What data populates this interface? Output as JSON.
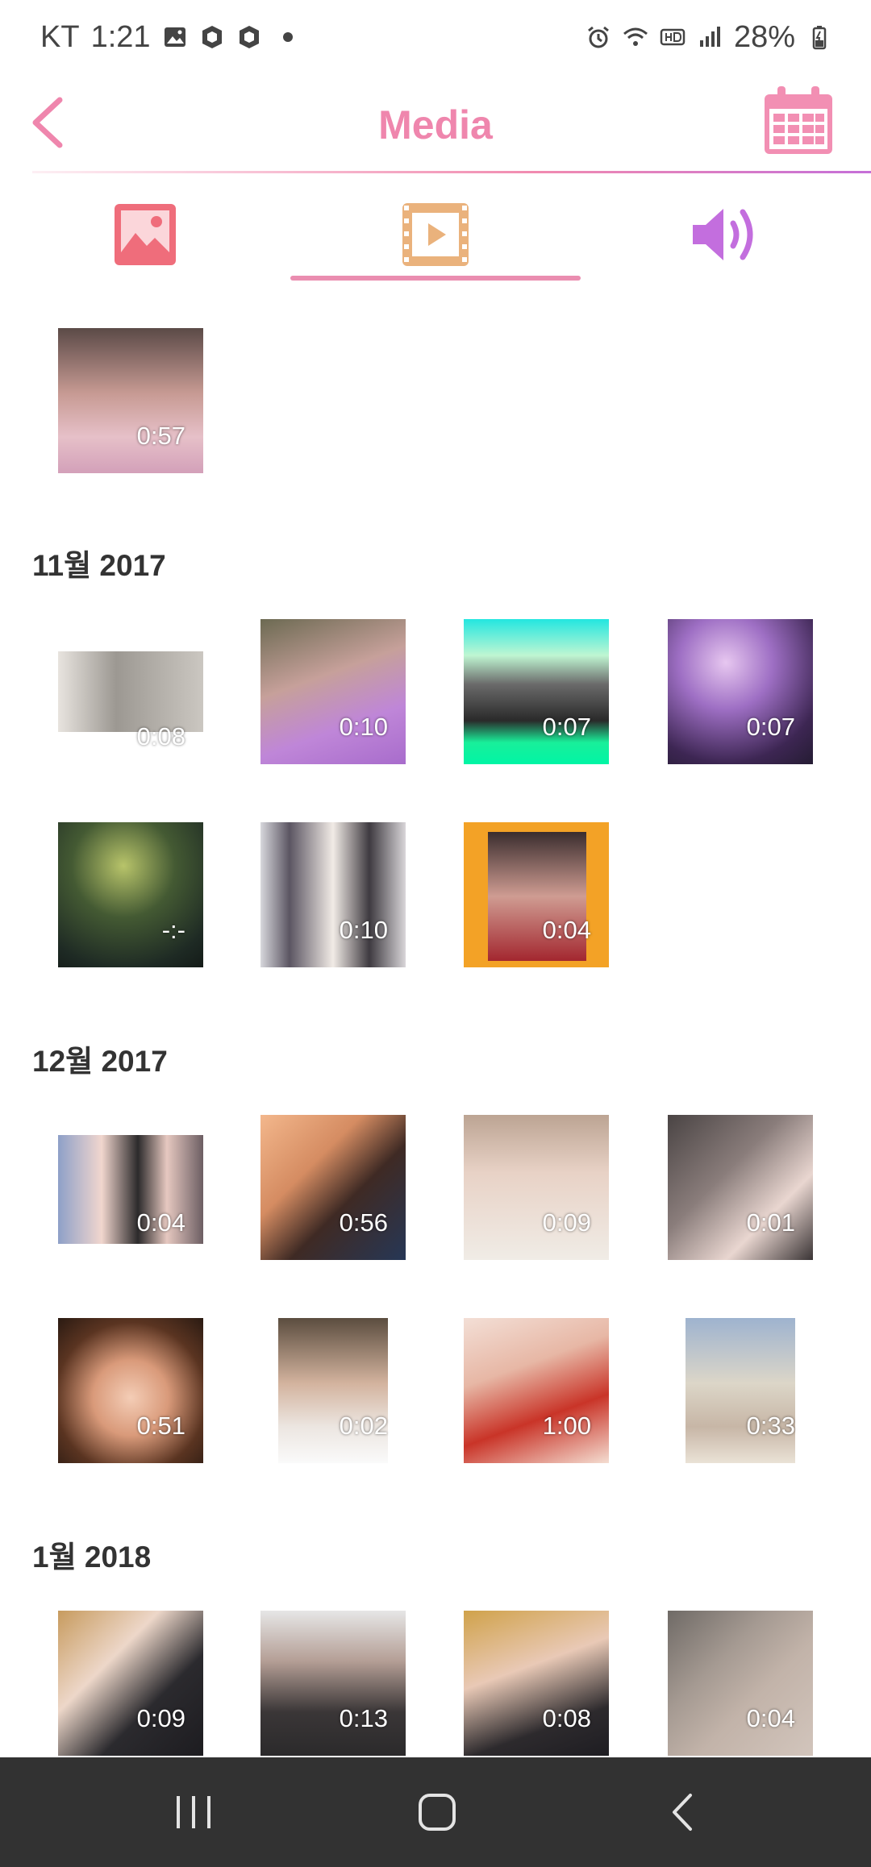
{
  "status_bar": {
    "carrier": "KT",
    "time": "1:21",
    "battery": "28%"
  },
  "app_bar": {
    "title": "Media"
  },
  "tabs": [
    {
      "name": "photos",
      "icon": "image-icon",
      "color": "#ef6d7b"
    },
    {
      "name": "videos",
      "icon": "video-icon",
      "color": "#eab27c",
      "selected": true
    },
    {
      "name": "audio",
      "icon": "speaker-icon",
      "color": "#c36ede"
    }
  ],
  "sections": [
    {
      "title": "",
      "videos": [
        {
          "duration": "0:57"
        }
      ]
    },
    {
      "title": "11월 2017",
      "videos": [
        {
          "duration": "0:08"
        },
        {
          "duration": "0:10"
        },
        {
          "duration": "0:07"
        },
        {
          "duration": "0:07"
        },
        {
          "duration": "-:-"
        },
        {
          "duration": "0:10"
        },
        {
          "duration": "0:04"
        }
      ]
    },
    {
      "title": "12월 2017",
      "videos": [
        {
          "duration": "0:04"
        },
        {
          "duration": "0:56"
        },
        {
          "duration": "0:09"
        },
        {
          "duration": "0:01"
        },
        {
          "duration": "0:51"
        },
        {
          "duration": "0:02"
        },
        {
          "duration": "1:00"
        },
        {
          "duration": "0:33"
        }
      ]
    },
    {
      "title": "1월 2018",
      "videos": [
        {
          "duration": "0:09"
        },
        {
          "duration": "0:13"
        },
        {
          "duration": "0:08"
        },
        {
          "duration": "0:04"
        }
      ]
    }
  ],
  "colors": {
    "accent_pink": "#ef86ad",
    "nav_bar": "#323232"
  }
}
